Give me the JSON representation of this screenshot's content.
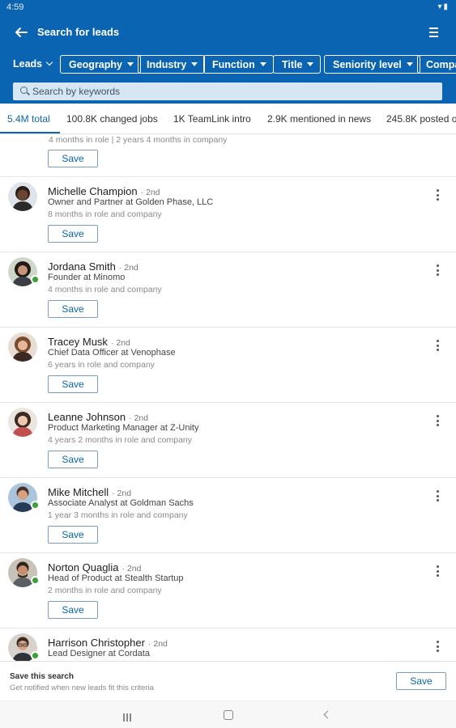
{
  "status_bar": {
    "time": "4:59"
  },
  "app_bar": {
    "title": "Search for leads"
  },
  "filters": {
    "leads_label": "Leads",
    "chips": [
      "Geography",
      "Industry",
      "Function",
      "Title",
      "Seniority level",
      "Compa"
    ]
  },
  "search": {
    "placeholder": "Search by keywords",
    "value": ""
  },
  "tabs": [
    {
      "label": "5.4M total",
      "active": true
    },
    {
      "label": "100.8K changed jobs",
      "active": false
    },
    {
      "label": "1K TeamLink intro",
      "active": false
    },
    {
      "label": "2.9K mentioned in news",
      "active": false
    },
    {
      "label": "245.8K posted o",
      "active": false
    }
  ],
  "partial_lead": {
    "tenure": "4 months in role | 2 years 4 months in company",
    "save_label": "Save"
  },
  "leads": [
    {
      "name": "Michelle Champion",
      "degree": "2nd",
      "title": "Owner and Partner at Golden Phase, LLC",
      "tenure": "8 months in role and company",
      "save_label": "Save",
      "online": false
    },
    {
      "name": "Jordana Smith",
      "degree": "2nd",
      "title": "Founder at Minomo",
      "tenure": "4 months in role and company",
      "save_label": "Save",
      "online": true
    },
    {
      "name": "Tracey Musk",
      "degree": "2nd",
      "title": "Chief Data Officer at Venophase",
      "tenure": "6 years in role and company",
      "save_label": "Save",
      "online": false
    },
    {
      "name": "Leanne Johnson",
      "degree": "2nd",
      "title": "Product Marketing Manager at Z-Unity",
      "tenure": "4 years 2 months in role and company",
      "save_label": "Save",
      "online": false
    },
    {
      "name": "Mike Mitchell",
      "degree": "2nd",
      "title": "Associate Analyst at Goldman Sachs",
      "tenure": "1 year 3 months in role and company",
      "save_label": "Save",
      "online": true
    },
    {
      "name": "Norton Quaglia",
      "degree": "2nd",
      "title": "Head of Product at Stealth Startup",
      "tenure": "2 months in role and company",
      "save_label": "Save",
      "online": true
    },
    {
      "name": "Harrison Christopher",
      "degree": "2nd",
      "title": "Lead Designer at Cordata",
      "tenure": "",
      "save_label": "Save",
      "online": true
    }
  ],
  "save_search": {
    "title": "Save this search",
    "subtitle": "Get notified when new leads fit this criteria",
    "button_label": "Save"
  },
  "colors": {
    "brand": "#0b64b1",
    "online": "#3aa135"
  },
  "icons": [
    "back-arrow-icon",
    "menu-icon",
    "search-icon",
    "more-vertical-icon",
    "nav-recents-icon",
    "nav-home-icon",
    "nav-back-icon"
  ]
}
